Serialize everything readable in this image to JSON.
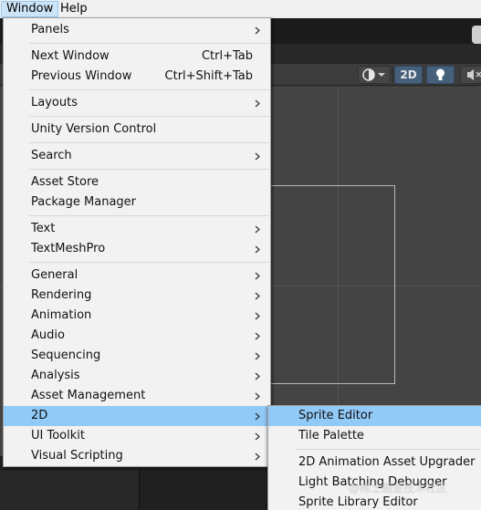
{
  "menubar": {
    "items": [
      {
        "label": "Window"
      },
      {
        "label": "Help"
      }
    ]
  },
  "scene_toolbar": {
    "button_2d": "2D"
  },
  "window_menu": {
    "items": [
      {
        "label": "Panels",
        "submenu": true
      },
      {
        "label": "Next Window",
        "shortcut": "Ctrl+Tab"
      },
      {
        "label": "Previous Window",
        "shortcut": "Ctrl+Shift+Tab"
      },
      {
        "label": "Layouts",
        "submenu": true
      },
      {
        "label": "Unity Version Control"
      },
      {
        "label": "Search",
        "submenu": true
      },
      {
        "label": "Asset Store"
      },
      {
        "label": "Package Manager"
      },
      {
        "label": "Text",
        "submenu": true
      },
      {
        "label": "TextMeshPro",
        "submenu": true
      },
      {
        "label": "General",
        "submenu": true
      },
      {
        "label": "Rendering",
        "submenu": true
      },
      {
        "label": "Animation",
        "submenu": true
      },
      {
        "label": "Audio",
        "submenu": true
      },
      {
        "label": "Sequencing",
        "submenu": true
      },
      {
        "label": "Analysis",
        "submenu": true
      },
      {
        "label": "Asset Management",
        "submenu": true
      },
      {
        "label": "2D",
        "submenu": true,
        "highlighted": true
      },
      {
        "label": "UI Toolkit",
        "submenu": true
      },
      {
        "label": "Visual Scripting",
        "submenu": true
      }
    ]
  },
  "submenu_2d": {
    "items": [
      {
        "label": "Sprite Editor",
        "highlighted": true
      },
      {
        "label": "Tile Palette"
      },
      {
        "label": "2D Animation Asset Upgrader"
      },
      {
        "label": "Light Batching Debugger"
      },
      {
        "label": "Sprite Library Editor"
      }
    ]
  },
  "watermark": "@稀土掘金技术社区",
  "colors": {
    "menu_bg": "#f2f2f2",
    "highlight": "#91c9f7",
    "menubar_active": "#cce4f7",
    "scene_bg": "#444444",
    "toggle_on": "#46607c"
  }
}
